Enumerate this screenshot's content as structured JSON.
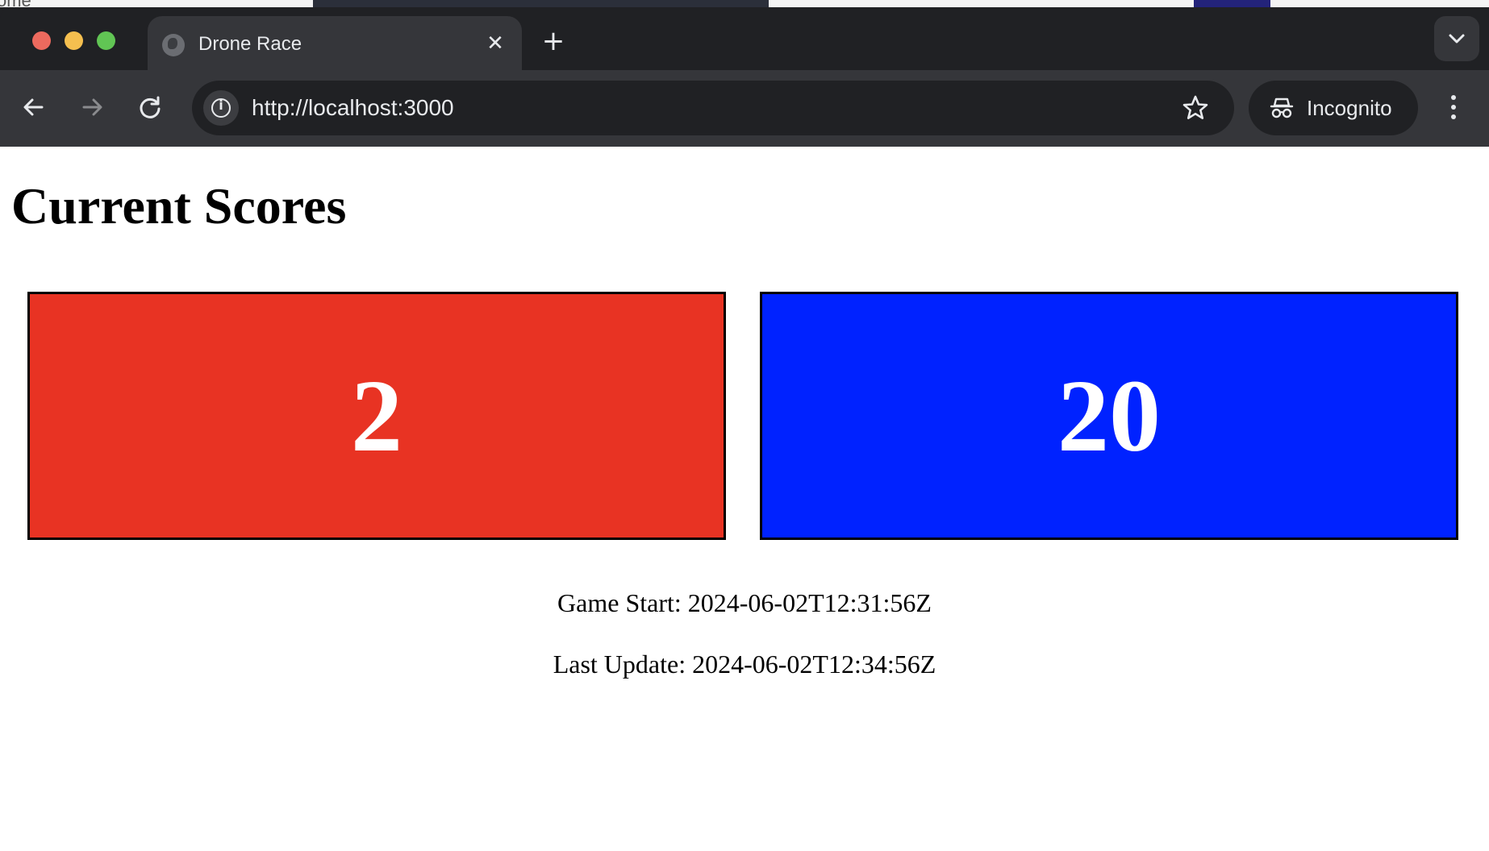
{
  "browser": {
    "tab_title": "Drone Race",
    "url": "http://localhost:3000",
    "incognito_label": "Incognito",
    "icons": [
      "close-icon",
      "plus-icon",
      "chevron-down-icon",
      "back-arrow-icon",
      "forward-arrow-icon",
      "reload-icon",
      "info-icon",
      "star-icon",
      "incognito-icon",
      "kebab-menu-icon"
    ]
  },
  "page": {
    "title": "Current Scores",
    "teams": [
      {
        "score": "2",
        "color": "#e83323"
      },
      {
        "score": "20",
        "color": "#0022ff"
      }
    ],
    "game_start": "Game Start: 2024-06-02T12:31:56Z",
    "last_update": "Last Update: 2024-06-02T12:34:56Z"
  }
}
